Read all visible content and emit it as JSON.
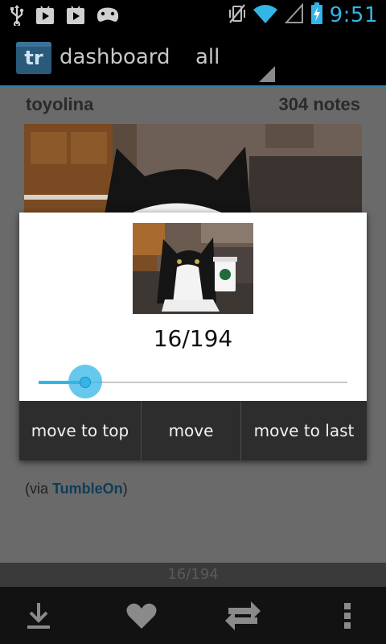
{
  "status_bar": {
    "notification_icons": [
      "usb-icon",
      "play-store-icon",
      "play-store-icon",
      "game-controller-icon"
    ],
    "system_icons": [
      "vibrate-mute-icon",
      "wifi-icon",
      "signal-icon",
      "battery-charging-icon"
    ],
    "time": "9:51",
    "accent_color": "#33b5e5"
  },
  "action_bar": {
    "logo_text": "tr",
    "title": "dashboard",
    "filter": "all"
  },
  "post": {
    "username": "toyolina",
    "notes": "304 notes",
    "via_prefix": "(via ",
    "via_link": "TumbleOn",
    "via_suffix": ")"
  },
  "dialog": {
    "counter": "16/194",
    "slider": {
      "value": 16,
      "max": 194
    },
    "buttons": {
      "move_to_top": "move to top",
      "move": "move",
      "move_to_last": "move to last"
    }
  },
  "page_indicator": "16/194",
  "bottom_bar": {
    "icons": [
      "download-icon",
      "heart-icon",
      "reblog-icon",
      "overflow-menu-icon"
    ]
  }
}
